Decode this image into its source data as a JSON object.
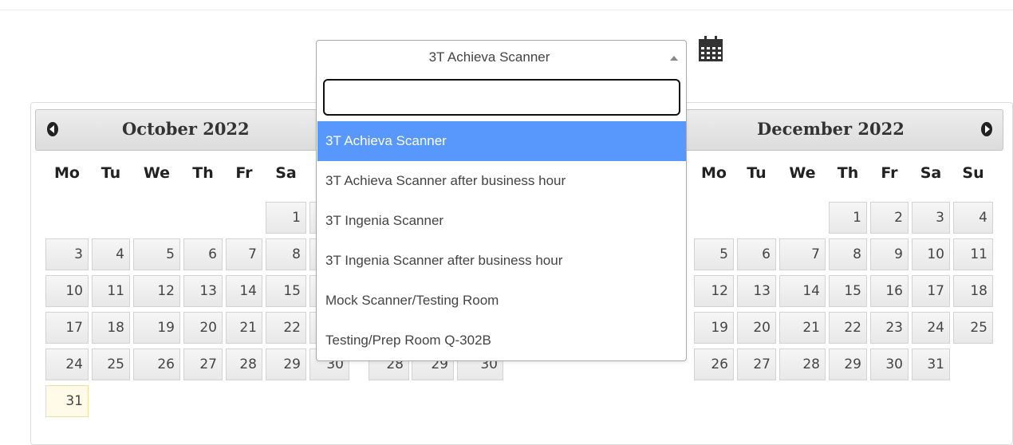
{
  "scanner_select": {
    "selected": "3T Achieva Scanner",
    "search_value": "",
    "options": [
      "3T Achieva Scanner",
      "3T Achieva Scanner after business hour",
      "3T Ingenia Scanner",
      "3T Ingenia Scanner after business hour",
      "Mock Scanner/Testing Room",
      "Testing/Prep Room Q-302B"
    ],
    "highlighted_index": 0
  },
  "calendar_icon": "calendar-icon",
  "calendars": {
    "left": {
      "title": "October 2022",
      "weekdays": [
        "Mo",
        "Tu",
        "We",
        "Th",
        "Fr",
        "Sa"
      ],
      "rows": [
        [
          "",
          "",
          "",
          "",
          "",
          "1"
        ],
        [
          "3",
          "4",
          "5",
          "6",
          "7",
          "8"
        ],
        [
          "10",
          "11",
          "12",
          "13",
          "14",
          "15"
        ],
        [
          "17",
          "18",
          "19",
          "20",
          "21",
          "22"
        ],
        [
          "24",
          "25",
          "26",
          "27",
          "28",
          "29"
        ],
        [
          "31",
          "",
          "",
          "",
          "",
          ""
        ]
      ],
      "partial_col_values": [
        "30"
      ],
      "today": "31"
    },
    "middle_partial": [
      "28",
      "29",
      "30"
    ],
    "right": {
      "title": "December 2022",
      "weekdays": [
        "Mo",
        "Tu",
        "We",
        "Th",
        "Fr",
        "Sa",
        "Su"
      ],
      "rows": [
        [
          "",
          "",
          "",
          "1",
          "2",
          "3",
          "4"
        ],
        [
          "5",
          "6",
          "7",
          "8",
          "9",
          "10",
          "11"
        ],
        [
          "12",
          "13",
          "14",
          "15",
          "16",
          "17",
          "18"
        ],
        [
          "19",
          "20",
          "21",
          "22",
          "23",
          "24",
          "25"
        ],
        [
          "26",
          "27",
          "28",
          "29",
          "30",
          "31",
          ""
        ]
      ]
    }
  },
  "colors": {
    "highlight": "#5897fb",
    "today_bg": "#fffbe8"
  }
}
